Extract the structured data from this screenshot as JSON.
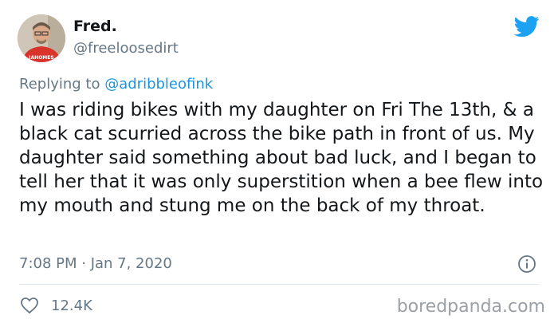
{
  "user": {
    "display_name": "Fred.",
    "handle": "@freeloosedirt",
    "avatar_shirt_text": "IAHOMES"
  },
  "reply": {
    "prefix": "Replying to",
    "mention": "@adribbleofink"
  },
  "tweet": {
    "text": "I was riding bikes with my daughter on Fri The 13th, & a black cat scurried across the bike path in front of us. My daughter said something about bad luck, and I began to tell her that it was only superstition when a bee flew into my mouth and stung me on the back of my throat.",
    "timestamp": "7:08 PM · Jan 7, 2020"
  },
  "stats": {
    "likes": "12.4K"
  },
  "icons": {
    "brand": "twitter-bird-icon",
    "info": "info-icon",
    "like": "heart-icon"
  },
  "colors": {
    "twitter_blue": "#1da1f2",
    "mention": "#1b95e0",
    "secondary_text": "#657786"
  },
  "watermark": "boredpanda.com"
}
